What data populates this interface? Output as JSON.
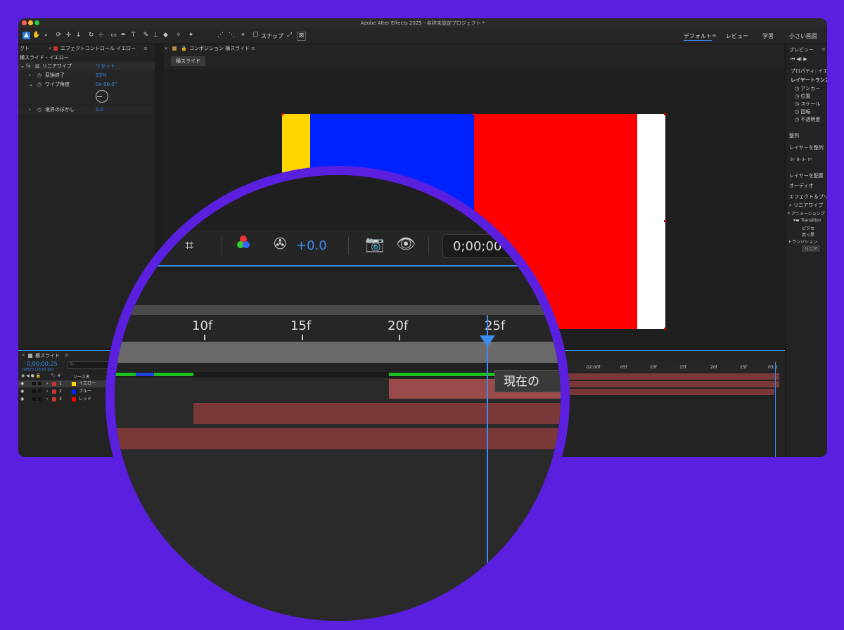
{
  "titlebar": {
    "title": "Adobe After Effects 2025 - 名称未設定プロジェクト *"
  },
  "toolbar": {
    "snap_label": "スナップ"
  },
  "workspaces": [
    {
      "label": "デフォルト",
      "active": true
    },
    {
      "label": "レビュー",
      "active": false
    },
    {
      "label": "学習",
      "active": false
    },
    {
      "label": "小さい画面",
      "active": false
    }
  ],
  "left_panel": {
    "tab_left": "クト",
    "tab_title": "エフェクトコントロール イエロー",
    "layer_path": "横スライド・イエロー",
    "effect_name": "リニアワイプ",
    "reset_label": "リセット",
    "props": [
      {
        "label": "変換終了",
        "value": "93%"
      },
      {
        "label": "ワイプ角度",
        "value": "0x-90.0°"
      },
      {
        "label": "境界のぼかし",
        "value": "0.0"
      }
    ]
  },
  "comp_panel": {
    "tab_title": "コンポジション 横スライド",
    "comp_tab": "横スライド",
    "colors": {
      "yellow": "#FFD600",
      "blue": "#0022FF",
      "red": "#FF0000",
      "white": "#FFFFFF"
    }
  },
  "right_panel": {
    "preview": "プレビュー",
    "properties": "プロパティ: イエ",
    "layer_transform": "レイヤートランス",
    "transform_items": [
      "アンカー",
      "位置",
      "スケール",
      "回転",
      "不透明度"
    ],
    "align": "整列",
    "align_to": "レイヤーを整列",
    "distribute": "レイヤーを配置",
    "audio": "オーディオ",
    "effects_presets": "エフェクト＆プリ",
    "search": "リニアワイプ",
    "animation_presets": "* アニメーションプ",
    "transitions_folder": "Transition",
    "preset_1": "ピクセ",
    "preset_2": "真っ黒",
    "transition": "トランジション",
    "transition_item": "リニア"
  },
  "timeline": {
    "comp_name": "横スライド",
    "timecode": "0;00;00;25",
    "fps": "00025 (29.97 fps)",
    "source_name_header": "ソース名",
    "search_placeholder": "Q₊",
    "ruler_labels": [
      "02:00f",
      "05f",
      "10f",
      "15f",
      "20f",
      "25f",
      "03:0"
    ],
    "layers": [
      {
        "num": "1",
        "name": "イエロー",
        "color": "#FFD600"
      },
      {
        "num": "2",
        "name": "ブルー",
        "color": "#0022FF"
      },
      {
        "num": "3",
        "name": "レッド",
        "color": "#FF0000"
      }
    ]
  },
  "magnifier": {
    "exposure_value": "+0.0",
    "timecode_partial": "0;00;00",
    "ruler_labels": [
      "10f",
      "15f",
      "20f",
      "25f"
    ],
    "tooltip": "現在の"
  }
}
